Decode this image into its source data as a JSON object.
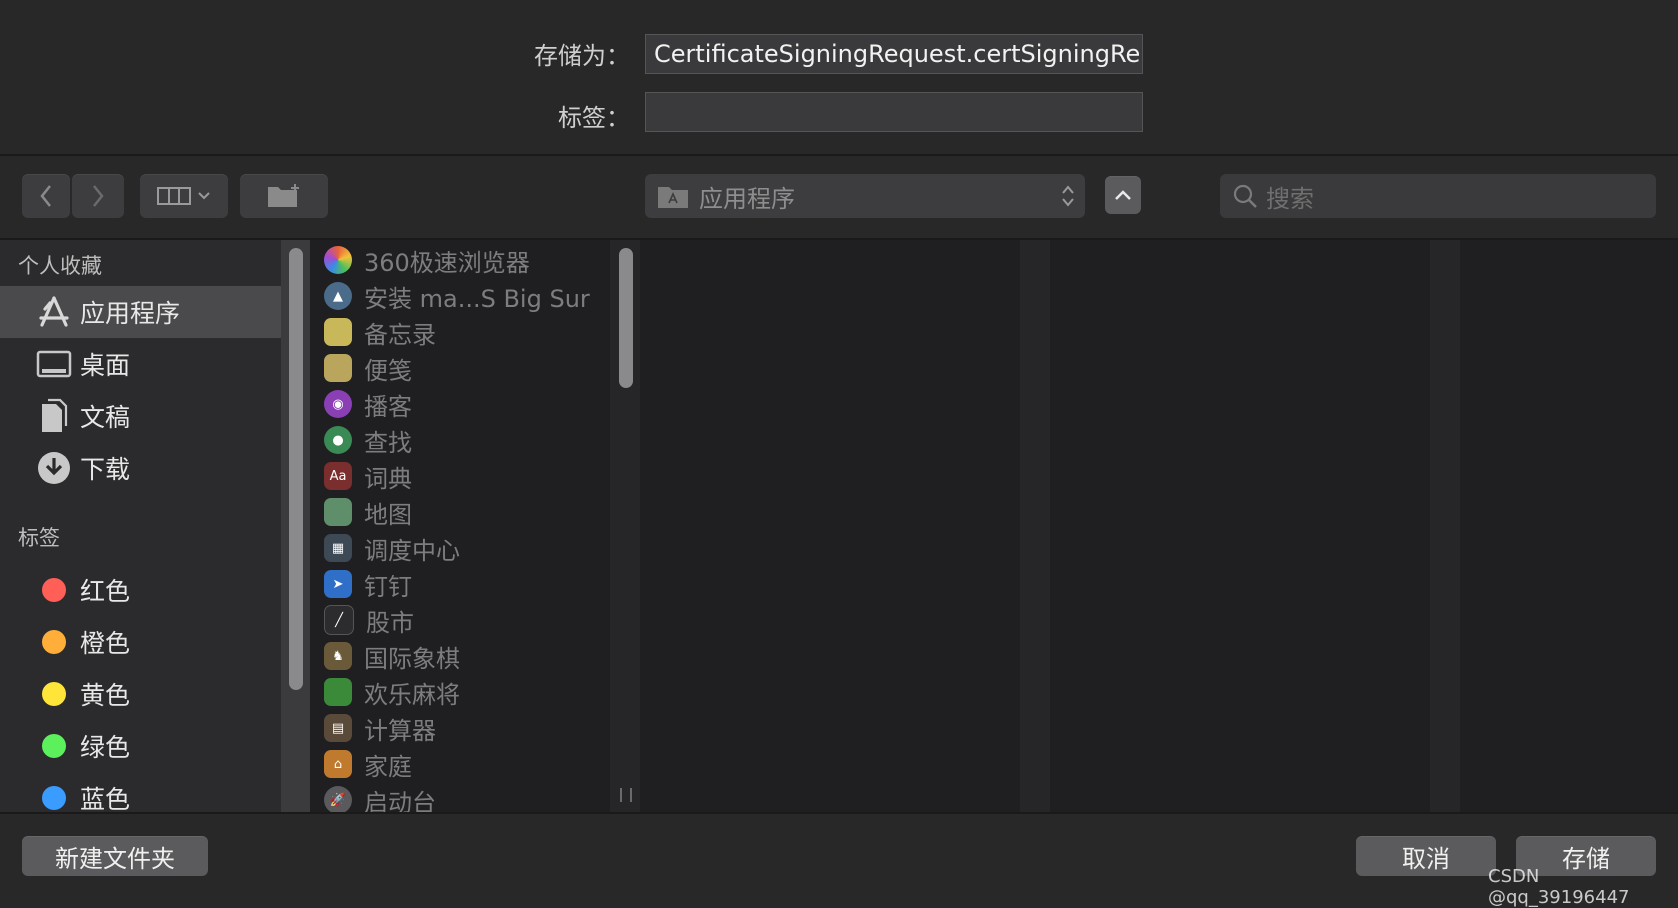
{
  "form": {
    "save_as_label": "存储为：",
    "save_as_value": "CertificateSigningRequest.certSigningRe",
    "tags_label": "标签：",
    "tags_value": ""
  },
  "toolbar": {
    "location": "应用程序",
    "search_placeholder": "搜索"
  },
  "sidebar": {
    "favorites_header": "个人收藏",
    "favorites": [
      {
        "label": "应用程序",
        "icon": "applications-icon",
        "selected": true
      },
      {
        "label": "桌面",
        "icon": "desktop-icon"
      },
      {
        "label": "文稿",
        "icon": "documents-icon"
      },
      {
        "label": "下载",
        "icon": "downloads-icon"
      }
    ],
    "tags_header": "标签",
    "tags": [
      {
        "label": "红色",
        "color": "#ff5f57"
      },
      {
        "label": "橙色",
        "color": "#ffae3a"
      },
      {
        "label": "黄色",
        "color": "#ffe53a"
      },
      {
        "label": "绿色",
        "color": "#5cf15c"
      },
      {
        "label": "蓝色",
        "color": "#3a9cff"
      }
    ]
  },
  "files": [
    {
      "name": "360极速浏览器",
      "icon": "browser-icon",
      "color": "#e8613c"
    },
    {
      "name": "安装 ma...S Big Sur",
      "icon": "installer-icon",
      "color": "#4a6b8a"
    },
    {
      "name": "备忘录",
      "icon": "notes-icon",
      "color": "#c8b85a"
    },
    {
      "name": "便笺",
      "icon": "stickies-icon",
      "color": "#b9a55c"
    },
    {
      "name": "播客",
      "icon": "podcasts-icon",
      "color": "#8b3fb5"
    },
    {
      "name": "查找",
      "icon": "find-my-icon",
      "color": "#3a8a55"
    },
    {
      "name": "词典",
      "icon": "dictionary-icon",
      "color": "#7a2e2e"
    },
    {
      "name": "地图",
      "icon": "maps-icon",
      "color": "#5e8f6a"
    },
    {
      "name": "调度中心",
      "icon": "mission-control-icon",
      "color": "#3d4a55"
    },
    {
      "name": "钉钉",
      "icon": "dingtalk-icon",
      "color": "#2f6fc7"
    },
    {
      "name": "股市",
      "icon": "stocks-icon",
      "color": "#2c2c2e"
    },
    {
      "name": "国际象棋",
      "icon": "chess-icon",
      "color": "#6b5a3a"
    },
    {
      "name": "欢乐麻将",
      "icon": "mahjong-icon",
      "color": "#3a8a3a"
    },
    {
      "name": "计算器",
      "icon": "calculator-icon",
      "color": "#5a4a3a"
    },
    {
      "name": "家庭",
      "icon": "home-icon",
      "color": "#c07a2e"
    },
    {
      "name": "启动台",
      "icon": "launchpad-icon",
      "color": "#5a5a5c"
    }
  ],
  "buttons": {
    "new_folder": "新建文件夹",
    "cancel": "取消",
    "save": "存储"
  },
  "watermark": "CSDN @qq_39196447"
}
